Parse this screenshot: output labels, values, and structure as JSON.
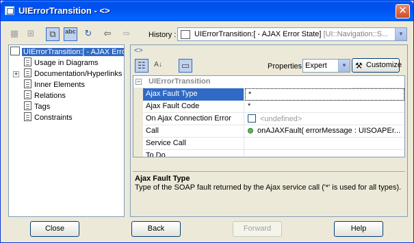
{
  "window": {
    "title": "UIErrorTransition - <>",
    "close_glyph": "✕"
  },
  "toolbar": {
    "history_label": "History :",
    "history_value": "UIErrorTransition:[ - AJAX Error State]",
    "history_value_muted": " [UI::Navigation::S...",
    "abc_label": "abc"
  },
  "tree": {
    "root_label": "UIErrorTransition:[ - AJAX Erro",
    "items": [
      {
        "label": "Usage in Diagrams",
        "expandable": false
      },
      {
        "label": "Documentation/Hyperlinks",
        "expandable": true
      },
      {
        "label": "Inner Elements",
        "expandable": false
      },
      {
        "label": "Relations",
        "expandable": false
      },
      {
        "label": "Tags",
        "expandable": false
      },
      {
        "label": "Constraints",
        "expandable": false
      }
    ]
  },
  "properties": {
    "breadcrumb": "<>",
    "mode_label": "Properties:",
    "mode_value": "Expert",
    "customize_label": "Customize",
    "group": "UIErrorTransition",
    "rows": [
      {
        "name": "Ajax Fault Type",
        "value": "*"
      },
      {
        "name": "Ajax Fault Code",
        "value": "*"
      },
      {
        "name": "On Ajax Connection Error",
        "value": "<undefined>"
      },
      {
        "name": "Call",
        "value": "onAJAXFault( errorMessage : UISOAPEr..."
      },
      {
        "name": "Service Call",
        "value": ""
      },
      {
        "name": "To Do",
        "value": ""
      }
    ],
    "description_title": "Ajax Fault Type",
    "description_text": "Type of the SOAP fault returned by the Ajax service call ('*' is used for all types)."
  },
  "buttons": {
    "close": "Close",
    "back": "Back",
    "forward": "Forward",
    "help": "Help"
  }
}
